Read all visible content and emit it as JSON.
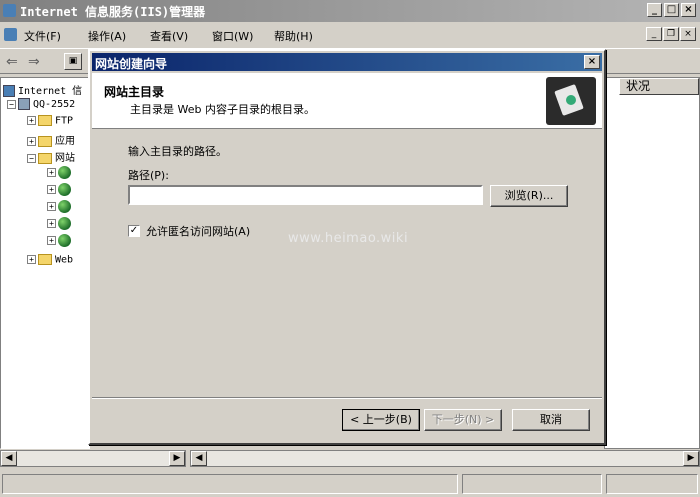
{
  "window": {
    "title": "Internet 信息服务(IIS)管理器"
  },
  "menu": {
    "items": [
      "文件(F)",
      "操作(A)",
      "查看(V)",
      "窗口(W)",
      "帮助(H)"
    ]
  },
  "tree": {
    "root": "Internet 信",
    "server": "QQ-2552",
    "ftp": "FTP",
    "apps": "应用",
    "sites": "网站",
    "web": "Web"
  },
  "list": {
    "column_status": "状况"
  },
  "dialog": {
    "title": "网站创建向导",
    "header_title": "网站主目录",
    "header_subtitle": "主目录是 Web 内容子目录的根目录。",
    "prompt": "输入主目录的路径。",
    "path_label": "路径(P):",
    "path_value": "",
    "browse_label": "浏览(R)...",
    "anon_checked": true,
    "anon_label": "允许匿名访问网站(A)",
    "back_label": "< 上一步(B)",
    "next_label": "下一步(N) >",
    "cancel_label": "取消"
  },
  "watermark": "www.heimao.wiki"
}
